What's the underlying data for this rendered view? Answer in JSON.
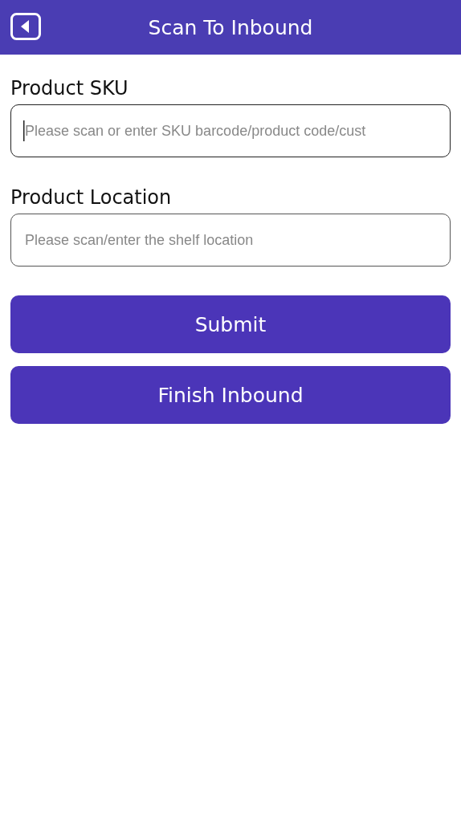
{
  "header": {
    "title": "Scan To Inbound"
  },
  "fields": [
    {
      "label": "Product SKU",
      "placeholder": "Please scan or enter SKU barcode/product code/cust",
      "focused": true
    },
    {
      "label": "Product Location",
      "placeholder": "Please scan/enter the shelf location",
      "focused": false
    }
  ],
  "buttons": [
    "Submit",
    "Finish Inbound"
  ]
}
